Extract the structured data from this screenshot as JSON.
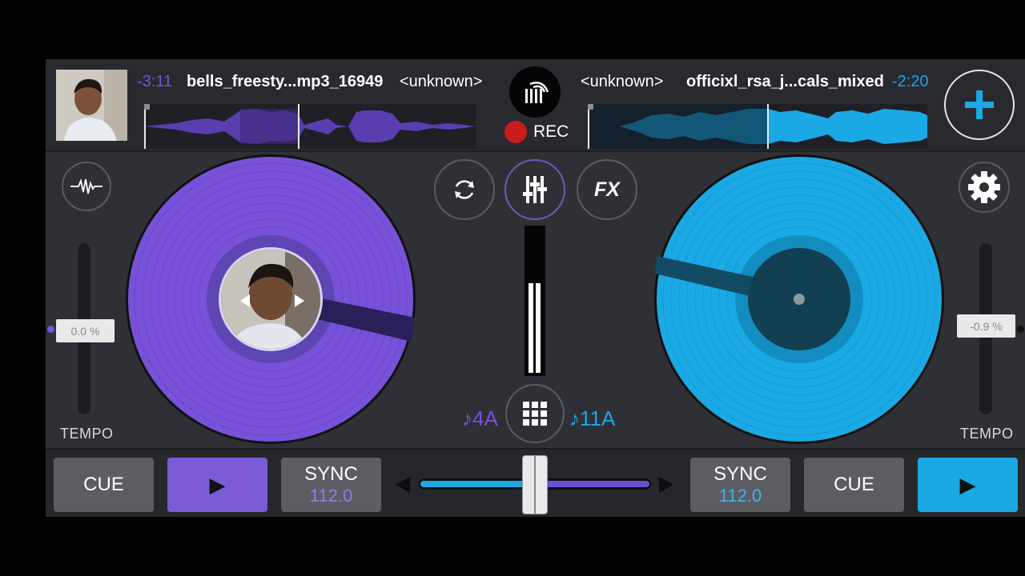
{
  "deck_a": {
    "time_remaining": "-3:11",
    "title": "bells_freesty...mp3_16949",
    "artist": "<unknown>",
    "tempo": "0.0 %",
    "tempo_label": "TEMPO",
    "key": "♪4A",
    "cue_label": "CUE",
    "play_label": "▶",
    "sync_label": "SYNC",
    "bpm": "112.0",
    "color": "#7851d9"
  },
  "deck_b": {
    "time_remaining": "-2:20",
    "title": "officixl_rsa_j...cals_mixed",
    "artist": "<unknown>",
    "tempo": "-0.9 %",
    "tempo_label": "TEMPO",
    "key": "♪11A",
    "cue_label": "CUE",
    "play_label": "▶",
    "sync_label": "SYNC",
    "bpm": "112.0",
    "color": "#1aa9e4"
  },
  "center": {
    "rec_label": "REC",
    "fx_label": "FX"
  },
  "icons": {
    "add": "plus-icon",
    "settings": "gear-icon",
    "waveform": "waveform-icon",
    "loop": "sync-loop-icon",
    "mixer": "mixer-sliders-icon",
    "library": "library-icon",
    "pads": "grid-pads-icon"
  },
  "crossfader": {
    "position": 0.5
  }
}
